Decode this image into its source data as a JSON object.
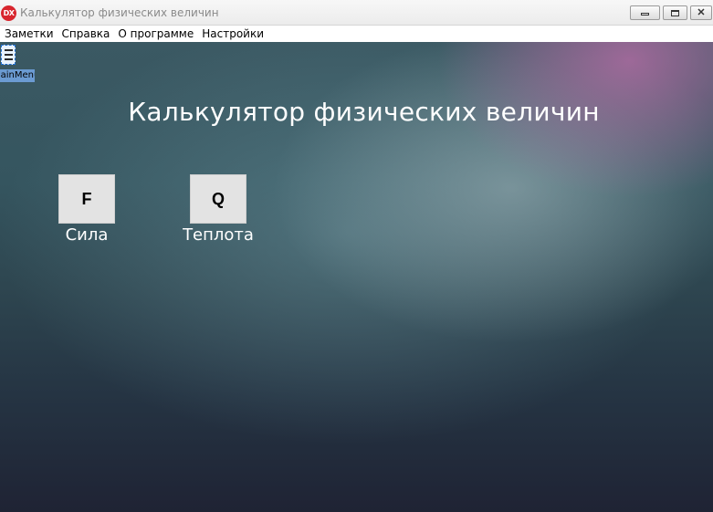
{
  "window": {
    "app_icon_text": "DX",
    "title": "Калькулятор физических величин"
  },
  "menu": {
    "items": [
      "Заметки",
      "Справка",
      "О программе",
      "Настройки"
    ]
  },
  "component": {
    "label": "MainMenu",
    "icon": "menu-component-icon"
  },
  "main": {
    "heading": "Калькулятор физических величин",
    "tiles": [
      {
        "glyph": "F",
        "label": "Сила"
      },
      {
        "glyph": "Q",
        "label": "Теплота"
      }
    ]
  },
  "colors": {
    "app_icon": "#d8262e",
    "tile_background": "#e3e3e3",
    "component_label_bg": "#6b9bd2"
  }
}
